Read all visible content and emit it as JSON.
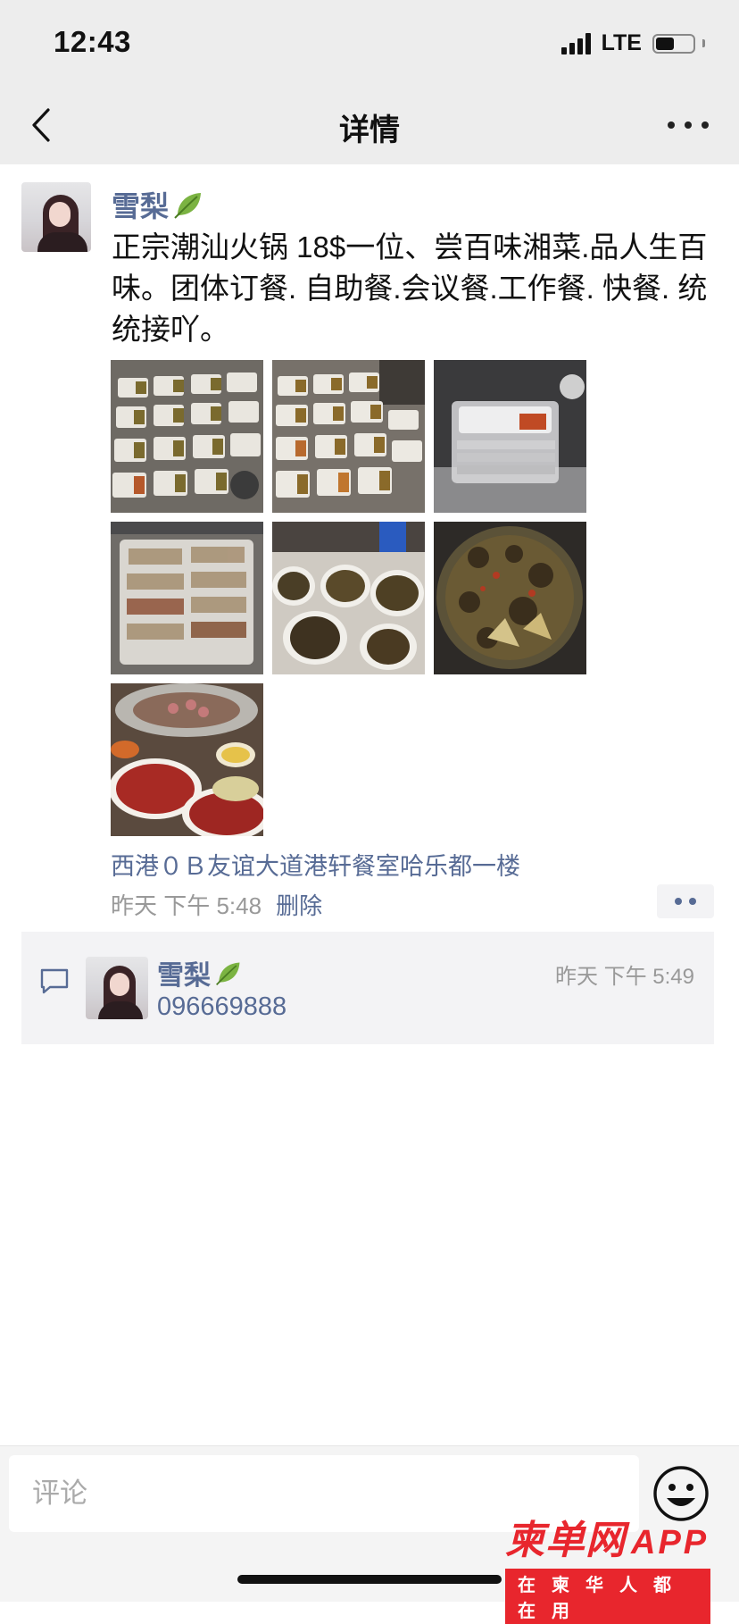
{
  "status": {
    "time": "12:43",
    "network": "LTE"
  },
  "nav": {
    "title": "详情"
  },
  "post": {
    "author": "雪梨",
    "text": "正宗潮汕火锅 18$一位、尝百味湘菜.品人生百味。团体订餐. 自助餐.会议餐.工作餐. 快餐. 统统接吖。",
    "photos": [
      {
        "icon": "photo-meal-boxes-rice"
      },
      {
        "icon": "photo-meal-boxes-rice-2"
      },
      {
        "icon": "photo-stacked-containers"
      },
      {
        "icon": "photo-packed-containers"
      },
      {
        "icon": "photo-bowls-of-stew"
      },
      {
        "icon": "photo-braised-dish"
      },
      {
        "icon": "photo-hotpot-sliced-beef"
      }
    ],
    "location": "西港０Ｂ友谊大道港轩餐室哈乐都一楼",
    "time": "昨天  下午 5:48",
    "delete_label": "删除"
  },
  "comment": {
    "author": "雪梨",
    "time": "昨天  下午 5:49",
    "text": "096669888"
  },
  "input": {
    "placeholder": "评论"
  },
  "watermark": {
    "main": "柬单网",
    "app": "APP",
    "sub": "在柬华人都在用"
  },
  "colors": {
    "link": "#576b95",
    "watermark": "#e8262d"
  }
}
